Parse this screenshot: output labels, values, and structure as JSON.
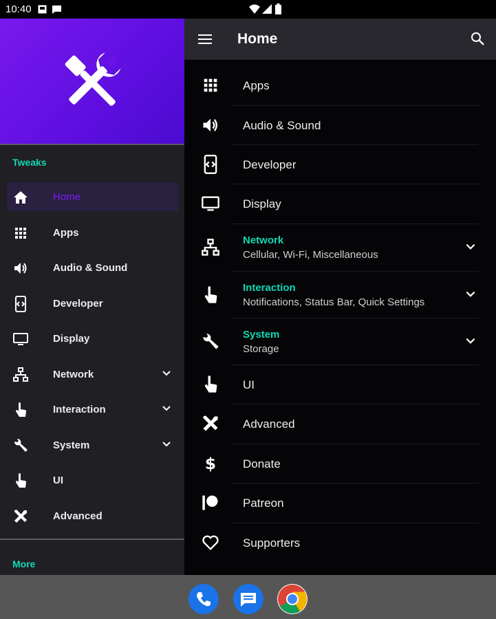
{
  "status_bar": {
    "time": "10:40"
  },
  "drawer": {
    "section_tweaks": "Tweaks",
    "section_more": "More",
    "items": [
      {
        "label": "Home",
        "icon": "home-icon",
        "active": true
      },
      {
        "label": "Apps",
        "icon": "apps-grid-icon"
      },
      {
        "label": "Audio & Sound",
        "icon": "volume-icon"
      },
      {
        "label": "Developer",
        "icon": "developer-icon"
      },
      {
        "label": "Display",
        "icon": "monitor-icon"
      },
      {
        "label": "Network",
        "icon": "network-icon",
        "expandable": true
      },
      {
        "label": "Interaction",
        "icon": "touch-icon",
        "expandable": true
      },
      {
        "label": "System",
        "icon": "wrench-icon",
        "expandable": true
      },
      {
        "label": "UI",
        "icon": "touch-icon"
      },
      {
        "label": "Advanced",
        "icon": "tools-icon"
      }
    ]
  },
  "appbar": {
    "title": "Home"
  },
  "main": {
    "rows": [
      {
        "label": "Apps",
        "icon": "apps-grid-icon"
      },
      {
        "label": "Audio & Sound",
        "icon": "volume-icon"
      },
      {
        "label": "Developer",
        "icon": "developer-icon"
      },
      {
        "label": "Display",
        "icon": "monitor-icon"
      },
      {
        "title": "Network",
        "subtitle": "Cellular, Wi-Fi, Miscellaneous",
        "icon": "network-icon"
      },
      {
        "title": "Interaction",
        "subtitle": "Notifications, Status Bar, Quick Settings",
        "icon": "touch-icon"
      },
      {
        "title": "System",
        "subtitle": "Storage",
        "icon": "wrench-icon"
      },
      {
        "label": "UI",
        "icon": "touch-icon"
      },
      {
        "label": "Advanced",
        "icon": "tools-icon"
      },
      {
        "label": "Donate",
        "icon": "dollar-icon"
      },
      {
        "label": "Patreon",
        "icon": "patreon-icon"
      },
      {
        "label": "Supporters",
        "icon": "heart-icon"
      }
    ]
  },
  "dock": {
    "apps": [
      "phone-icon",
      "messages-icon",
      "chrome-icon"
    ]
  },
  "colors": {
    "accent": "#12d9b4",
    "header_purple": "#6a12e8",
    "active_text": "#7a1cf5"
  }
}
